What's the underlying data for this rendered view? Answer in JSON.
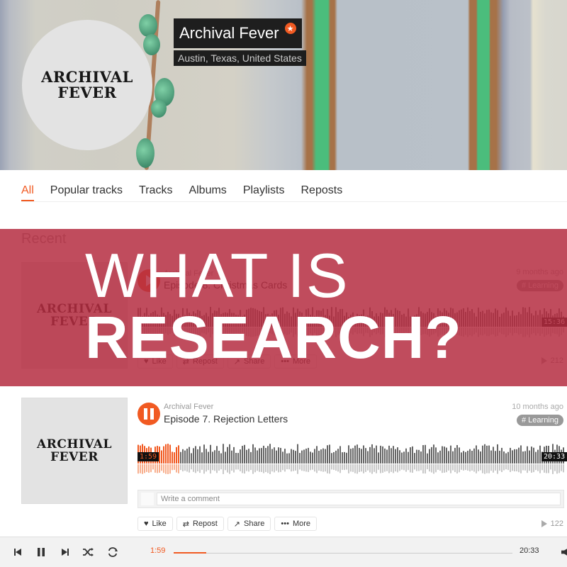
{
  "header": {
    "artist_name": "Archival Fever",
    "location": "Austin, Texas, United States",
    "avatar_logo_line1": "ARCHIVAL",
    "avatar_logo_line2": "FEVER",
    "pro_badge_icon": "star-icon"
  },
  "tabs": [
    {
      "label": "All",
      "active": true
    },
    {
      "label": "Popular tracks",
      "active": false
    },
    {
      "label": "Tracks",
      "active": false
    },
    {
      "label": "Albums",
      "active": false
    },
    {
      "label": "Playlists",
      "active": false
    },
    {
      "label": "Reposts",
      "active": false
    }
  ],
  "recent": {
    "section_title": "Recent",
    "tracks": [
      {
        "artist": "Archival Fever",
        "title": "Episode 8. Christmas Cards",
        "posted": "9 months ago",
        "tag": "# Learning",
        "duration": "15:36",
        "plays": "212",
        "art_line1": "ARCHIVAL",
        "art_line2": "FEVER",
        "state": "paused",
        "progress": 0
      },
      {
        "artist": "Archival Fever",
        "title": "Episode 7. Rejection Letters",
        "posted": "10 months ago",
        "tag": "# Learning",
        "current_time": "1:59",
        "duration": "20:33",
        "plays": "122",
        "art_line1": "ARCHIVAL",
        "art_line2": "FEVER",
        "state": "playing",
        "progress": 0.097,
        "comment_placeholder": "Write a comment",
        "actions": [
          {
            "label": "Like",
            "icon": "heart-icon"
          },
          {
            "label": "Repost",
            "icon": "repost-icon"
          },
          {
            "label": "Share",
            "icon": "share-icon"
          },
          {
            "label": "More",
            "icon": "more-icon"
          }
        ]
      }
    ]
  },
  "overlay": {
    "line1": "WHAT IS",
    "line2": "RESEARCH?"
  },
  "player": {
    "current_time": "1:59",
    "duration": "20:33",
    "progress": 0.097
  },
  "colors": {
    "accent": "#f15a22",
    "overlay": "#b52d41"
  }
}
